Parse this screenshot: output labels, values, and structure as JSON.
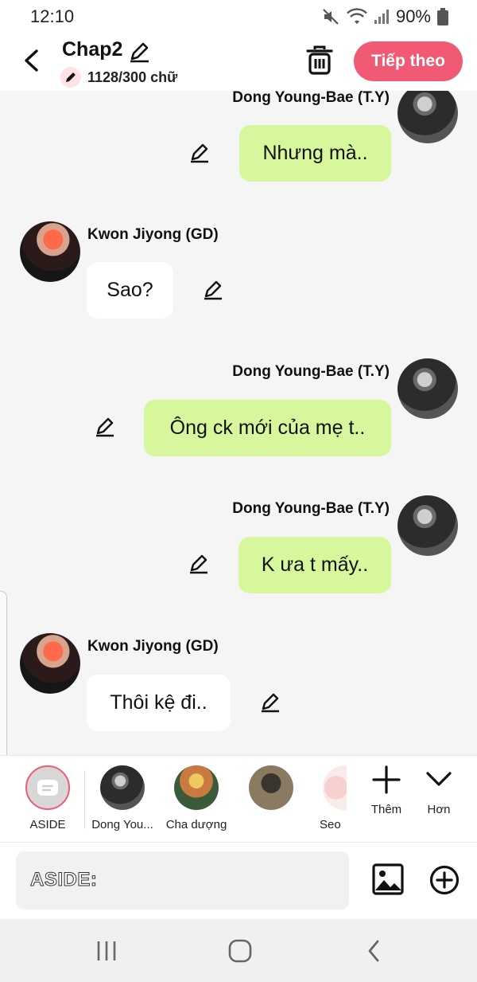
{
  "status_bar": {
    "time": "12:10",
    "battery": "90%"
  },
  "header": {
    "title": "Chap2",
    "word_count": "1128/300 chữ",
    "next_label": "Tiếp theo"
  },
  "messages": [
    {
      "name": "Dong Young-Bae (T.Y)",
      "text": "Nhưng mà..",
      "side": "right"
    },
    {
      "name": "Kwon Jiyong (GD)",
      "text": "Sao?",
      "side": "left"
    },
    {
      "name": "Dong Young-Bae (T.Y)",
      "text": "Ông ck mới của mẹ t..",
      "side": "right"
    },
    {
      "name": "Dong Young-Bae (T.Y)",
      "text": "K ưa t mấy..",
      "side": "right"
    },
    {
      "name": "Kwon Jiyong (GD)",
      "text": "Thôi kệ đi..",
      "side": "left"
    }
  ],
  "characters": [
    {
      "name": "ASIDE",
      "selected": true
    },
    {
      "name": "Dong You..."
    },
    {
      "name": "Cha dượng"
    },
    {
      "name": ""
    },
    {
      "name": "Seo"
    }
  ],
  "bar_actions": {
    "more_label": "Thêm",
    "collapse_label": "Hơn"
  },
  "input": {
    "label": "ASIDE:"
  },
  "colors": {
    "accent": "#f05a75",
    "bubble_right": "#d7f79c",
    "bubble_left": "#ffffff",
    "background": "#f5f5f5"
  }
}
